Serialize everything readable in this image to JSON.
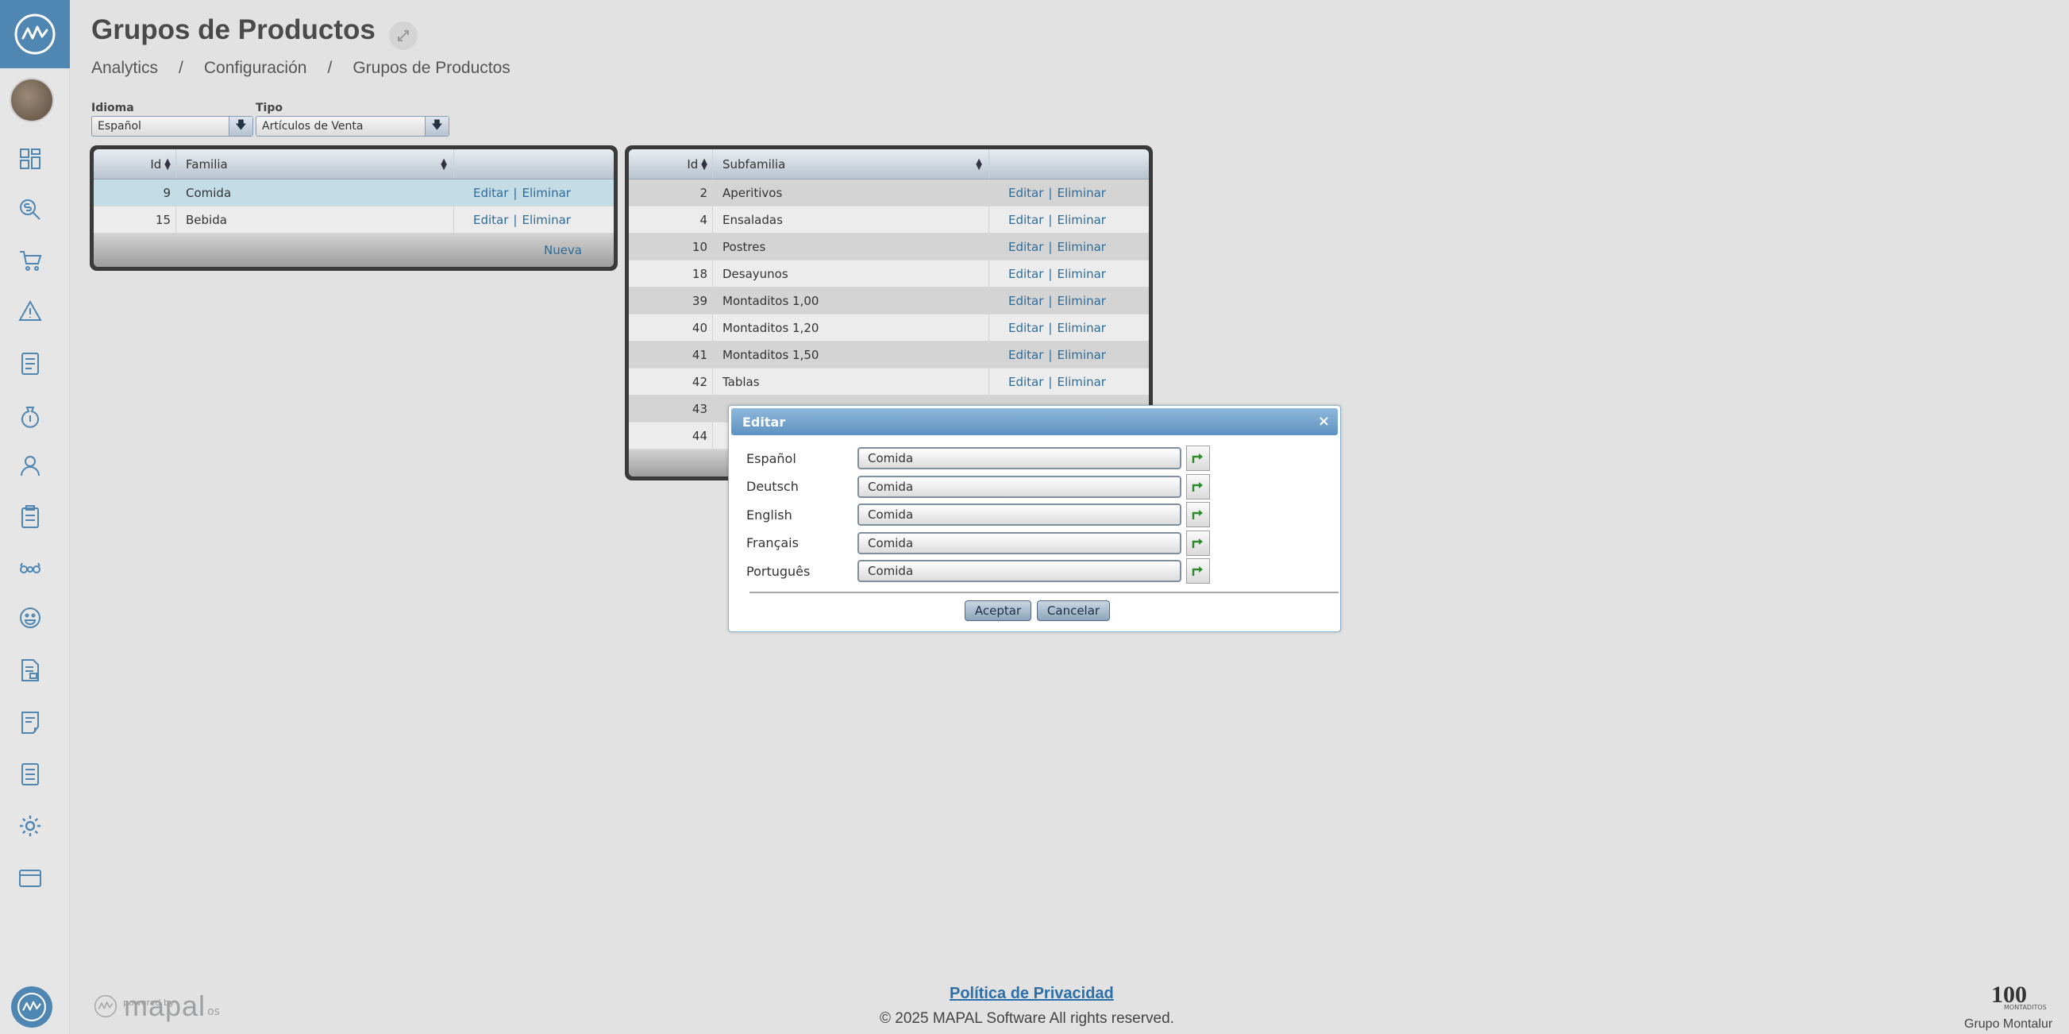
{
  "header": {
    "title": "Grupos de Productos",
    "breadcrumb": [
      "Analytics",
      "Configuración",
      "Grupos de Productos"
    ],
    "separator": "/"
  },
  "filters": {
    "idioma_label": "Idioma",
    "idioma_value": "Español",
    "tipo_label": "Tipo",
    "tipo_value": "Artículos de Venta"
  },
  "familia_grid": {
    "columns": [
      "Id",
      "Familia",
      ""
    ],
    "rows": [
      {
        "id": "9",
        "name": "Comida",
        "edit": "Editar",
        "delete": "Eliminar"
      },
      {
        "id": "15",
        "name": "Bebida",
        "edit": "Editar",
        "delete": "Eliminar"
      }
    ],
    "new_label": "Nueva"
  },
  "subfamilia_grid": {
    "columns": [
      "Id",
      "Subfamilia",
      ""
    ],
    "rows": [
      {
        "id": "2",
        "name": "Aperitivos",
        "edit": "Editar",
        "delete": "Eliminar"
      },
      {
        "id": "4",
        "name": "Ensaladas",
        "edit": "Editar",
        "delete": "Eliminar"
      },
      {
        "id": "10",
        "name": "Postres",
        "edit": "Editar",
        "delete": "Eliminar"
      },
      {
        "id": "18",
        "name": "Desayunos",
        "edit": "Editar",
        "delete": "Eliminar"
      },
      {
        "id": "39",
        "name": "Montaditos 1,00",
        "edit": "Editar",
        "delete": "Eliminar"
      },
      {
        "id": "40",
        "name": "Montaditos 1,20",
        "edit": "Editar",
        "delete": "Eliminar"
      },
      {
        "id": "41",
        "name": "Montaditos 1,50",
        "edit": "Editar",
        "delete": "Eliminar"
      },
      {
        "id": "42",
        "name": "Tablas",
        "edit": "Editar",
        "delete": "Eliminar"
      },
      {
        "id": "43",
        "name": "",
        "edit": "",
        "delete": ""
      },
      {
        "id": "44",
        "name": "",
        "edit": "",
        "delete": ""
      }
    ]
  },
  "dialog": {
    "title": "Editar",
    "close": "×",
    "fields": [
      {
        "label": "Español",
        "value": "Comida"
      },
      {
        "label": "Deutsch",
        "value": "Comida"
      },
      {
        "label": "English",
        "value": "Comida"
      },
      {
        "label": "Français",
        "value": "Comida"
      },
      {
        "label": "Português",
        "value": "Comida"
      }
    ],
    "accept": "Aceptar",
    "cancel": "Cancelar"
  },
  "footer": {
    "privacy": "Política de Privacidad",
    "copyright": "© 2025 MAPAL Software All rights reserved.",
    "powered_by": "powered by",
    "brand": "mapal",
    "brand_suffix": "os",
    "client_logo": "100",
    "client_logo_sub": "MONTADITOS",
    "client_name": "Grupo Montalur"
  },
  "colors": {
    "accent": "#4f86b2",
    "link": "#2e6b98",
    "selected_row": "#c3dce6"
  },
  "icons": {
    "sidebar": [
      "dashboard-icon",
      "money-search-icon",
      "cart-icon",
      "warning-icon",
      "report-icon",
      "money-bag-icon",
      "user-icon",
      "clipboard-icon",
      "binoculars-icon",
      "smiley-icon",
      "document-chart-icon",
      "invoice-icon",
      "list-icon",
      "gear-icon",
      "window-icon"
    ]
  }
}
